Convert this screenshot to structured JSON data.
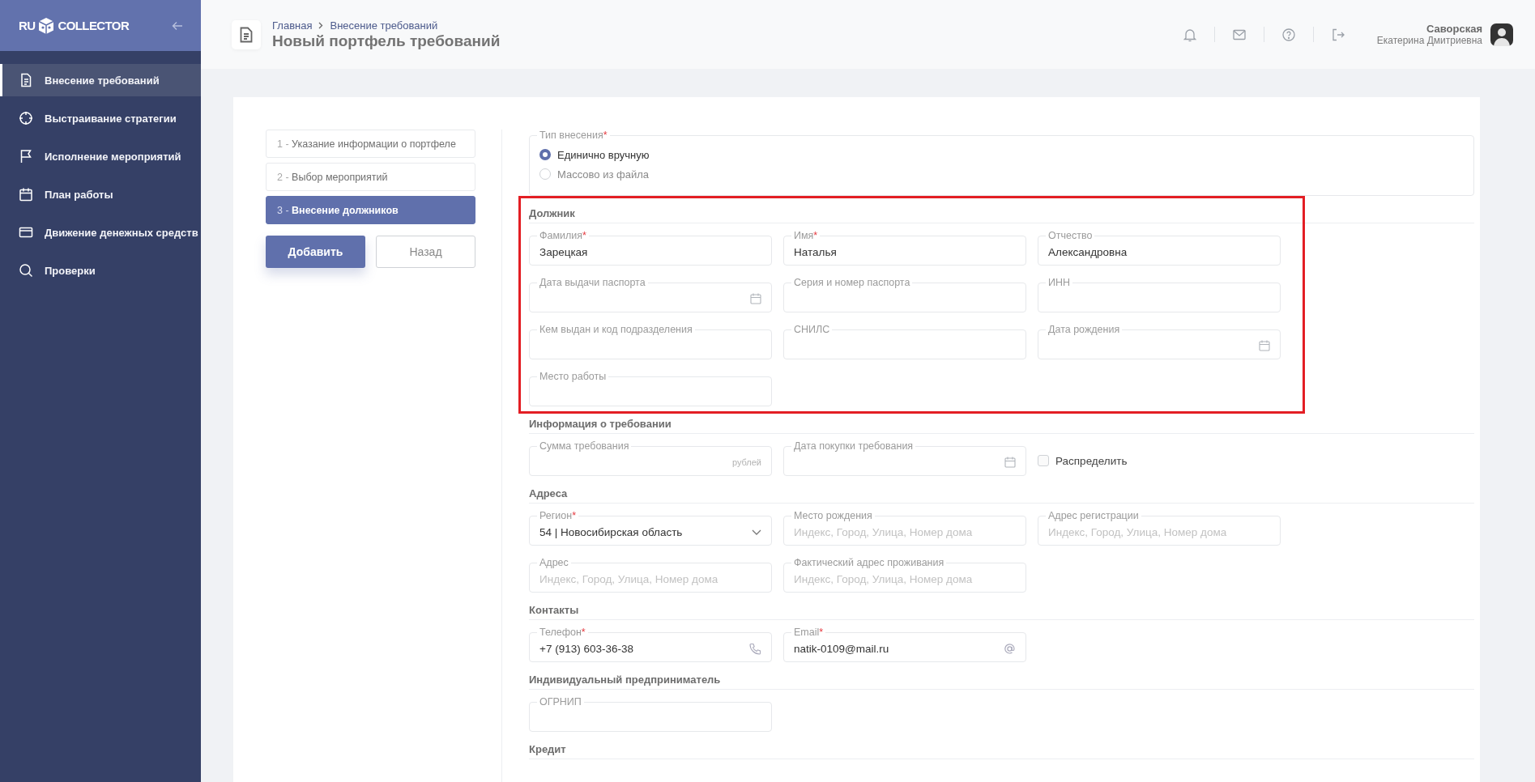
{
  "sidebar": {
    "logo_left": "RU",
    "logo_right": "COLLECTOR",
    "items": [
      {
        "label": "Внесение требований",
        "selected": true
      },
      {
        "label": "Выстраивание стратегии",
        "selected": false
      },
      {
        "label": "Исполнение мероприятий",
        "selected": false
      },
      {
        "label": "План работы",
        "selected": false
      },
      {
        "label": "Движение денежных средств",
        "selected": false
      },
      {
        "label": "Проверки",
        "selected": false
      }
    ]
  },
  "header": {
    "breadcrumbs": [
      "Главная",
      "Внесение требований"
    ],
    "title": "Новый портфель требований",
    "user": {
      "surname": "Саворская",
      "name": "Екатерина Дмитриевна"
    }
  },
  "steps": [
    {
      "number": "1 -",
      "label": "Указание информации о портфеле",
      "selected": false
    },
    {
      "number": "2 -",
      "label": "Выбор мероприятий",
      "selected": false
    },
    {
      "number": "3 -",
      "label": "Внесение должников",
      "selected": true
    }
  ],
  "buttons": [
    {
      "label": "Добавить",
      "kind": "primary"
    },
    {
      "label": "Назад",
      "kind": "secondary"
    }
  ],
  "entry_type": {
    "label": "Тип внесения",
    "required_mark": "*",
    "options": [
      {
        "label": "Единично вручную",
        "selected": true
      },
      {
        "label": "Массово из файла",
        "selected": false
      }
    ]
  },
  "sections": [
    {
      "title": "Должник",
      "highlighted": true,
      "fields": [
        {
          "kind": "text",
          "label": "Фамилия",
          "required_mark": "*",
          "value": "Зарецкая"
        },
        {
          "kind": "text",
          "label": "Имя",
          "required_mark": "*",
          "value": "Наталья"
        },
        {
          "kind": "text",
          "label": "Отчество",
          "value": "Александровна"
        },
        {
          "kind": "date",
          "label": "Дата выдачи паспорта"
        },
        {
          "kind": "text",
          "label": "Серия и номер паспорта"
        },
        {
          "kind": "text",
          "label": "ИНН"
        },
        {
          "kind": "text",
          "label": "Кем выдан и код подразделения"
        },
        {
          "kind": "text",
          "label": "СНИЛС"
        },
        {
          "kind": "date",
          "label": "Дата рождения"
        },
        {
          "kind": "text",
          "label": "Место работы"
        }
      ]
    },
    {
      "title": "Информация о требовании",
      "highlighted": false,
      "fields": [
        {
          "kind": "money",
          "label": "Сумма требования",
          "suffix": "рублей"
        },
        {
          "kind": "date",
          "label": "Дата покупки требования"
        },
        {
          "kind": "checkbox",
          "label": "Распределить",
          "checked": false
        }
      ]
    },
    {
      "title": "Адреса",
      "highlighted": false,
      "fields": [
        {
          "kind": "select",
          "label": "Регион",
          "required_mark": "*",
          "value": "54 | Новосибирская область"
        },
        {
          "kind": "text",
          "label": "Место рождения",
          "placeholder": "Индекс, Город, Улица, Номер дома"
        },
        {
          "kind": "text",
          "label": "Адрес регистрации",
          "placeholder": "Индекс, Город, Улица, Номер дома"
        },
        {
          "kind": "text",
          "label": "Адрес",
          "placeholder": "Индекс, Город, Улица, Номер дома"
        },
        {
          "kind": "text",
          "label": "Фактический адрес проживания",
          "placeholder": "Индекс, Город, Улица, Номер дома"
        }
      ]
    },
    {
      "title": "Контакты",
      "highlighted": false,
      "fields": [
        {
          "kind": "phone",
          "label": "Телефон",
          "required_mark": "*",
          "value": "+7 (913) 603-36-38"
        },
        {
          "kind": "email",
          "label": "Email",
          "required_mark": "*",
          "value": "natik-0109@mail.ru"
        }
      ]
    },
    {
      "title": "Индивидуальный предприниматель",
      "highlighted": false,
      "fields": [
        {
          "kind": "text",
          "label": "ОГРНИП"
        }
      ]
    },
    {
      "title": "Кредит",
      "highlighted": false
    }
  ]
}
